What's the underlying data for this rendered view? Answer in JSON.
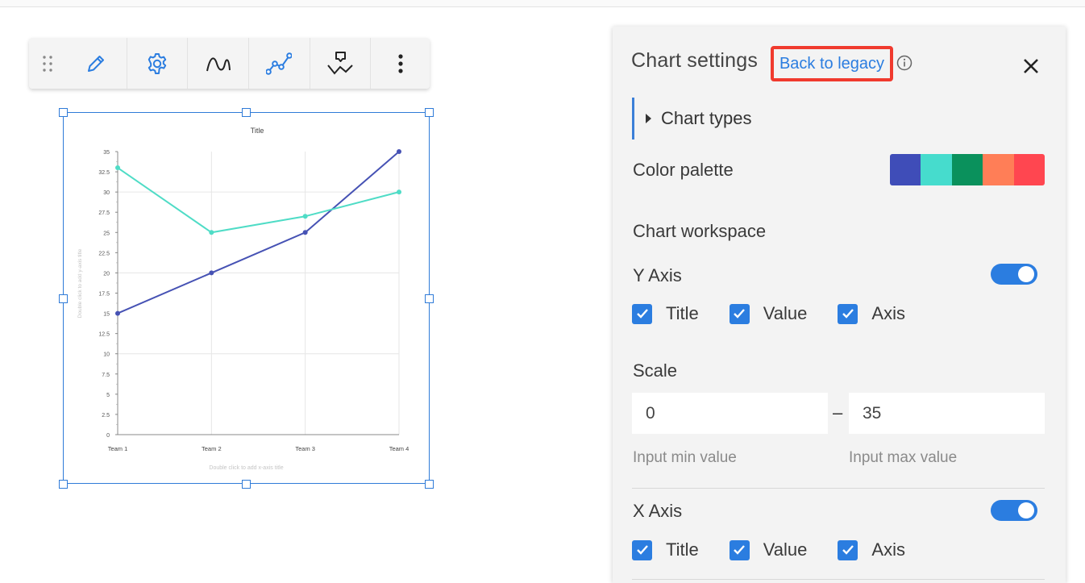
{
  "toolbar": {
    "icons": [
      "drag-handle-icon",
      "pencil-icon",
      "gear-icon",
      "curve-icon",
      "line-chart-icon",
      "chart-style-icon",
      "more-vertical-icon"
    ]
  },
  "chart": {
    "title": "Title",
    "ytitle_hint": "Double click to add y-axis title",
    "xtitle_hint": "Double click to add x-axis title"
  },
  "chart_data": {
    "type": "line",
    "title": "Title",
    "xlabel": "",
    "ylabel": "",
    "categories": [
      "Team 1",
      "Team 2",
      "Team 3",
      "Team 4"
    ],
    "ylim": [
      0,
      35
    ],
    "yticks": [
      "0",
      "2.5",
      "5",
      "7.5",
      "10",
      "12.5",
      "15",
      "17.5",
      "20",
      "22.5",
      "25",
      "27.5",
      "30",
      "32.5",
      "35"
    ],
    "series": [
      {
        "values": [
          15,
          20,
          25,
          35
        ],
        "color": "#4652b4"
      },
      {
        "values": [
          33,
          25,
          27,
          30
        ],
        "color": "#4fdcc6"
      }
    ],
    "grid": true
  },
  "panel": {
    "title": "Chart settings",
    "back_to_legacy": "Back to legacy",
    "chart_types": "Chart types",
    "color_palette": "Color palette",
    "palette_colors": [
      "#3f4db8",
      "#46dccd",
      "#0a915c",
      "#ff7e57",
      "#ff4650"
    ],
    "chart_workspace": "Chart workspace",
    "y_axis": "Y Axis",
    "x_axis": "X Axis",
    "check_title": "Title",
    "check_value": "Value",
    "check_axis": "Axis",
    "scale": "Scale",
    "min_value": "0",
    "max_value": "35",
    "min_hint": "Input min value",
    "max_hint": "Input max value",
    "dash": "–"
  }
}
